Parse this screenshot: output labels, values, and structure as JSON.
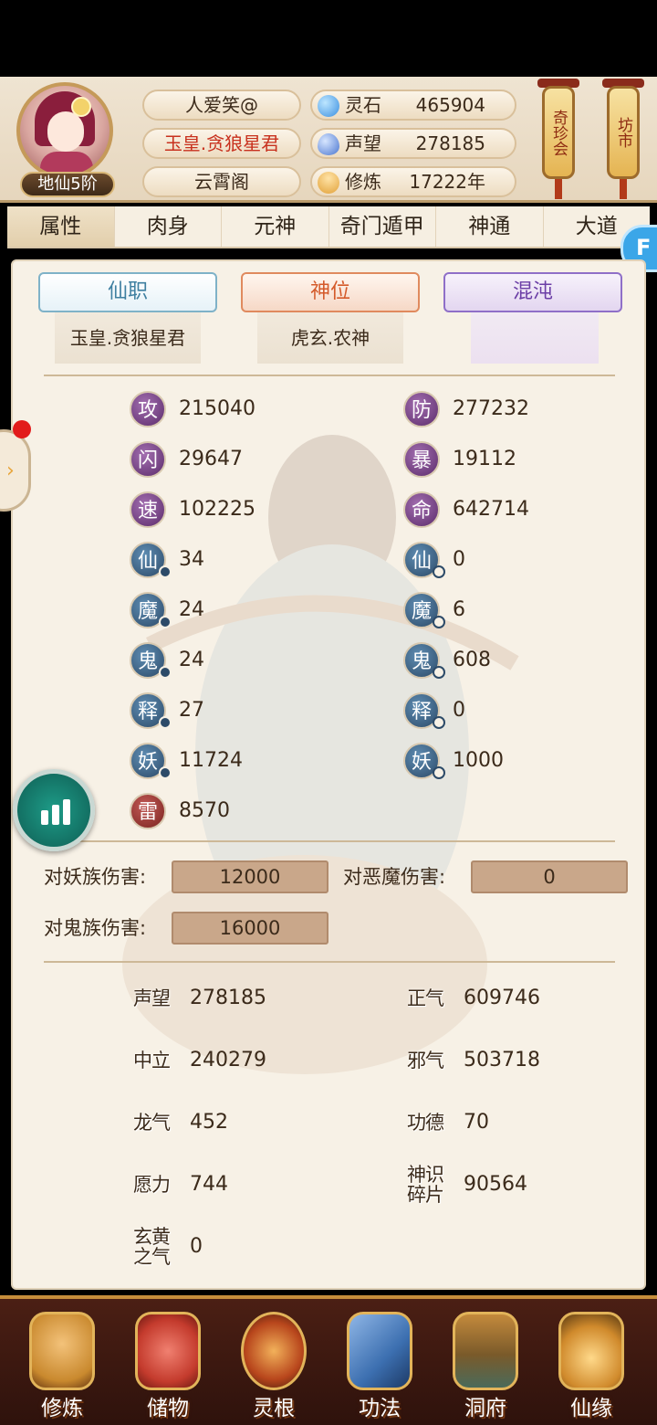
{
  "player": {
    "name": "人爱笑@",
    "title": "玉皇.贪狼星君",
    "sect": "云霄阁",
    "rank": "地仙5阶"
  },
  "resources": [
    {
      "label": "灵石",
      "value": "465904",
      "icon": "spirit-stone-icon",
      "color": "#3a8fe0"
    },
    {
      "label": "声望",
      "value": "278185",
      "icon": "reputation-icon",
      "color": "#4a76d0"
    },
    {
      "label": "修炼",
      "value": "17222年",
      "icon": "meditation-icon",
      "color": "#e2a23a"
    }
  ],
  "lanterns": [
    "奇珍会",
    "坊市"
  ],
  "tabs": [
    "属性",
    "肉身",
    "元神",
    "奇门遁甲",
    "神通",
    "大道"
  ],
  "float_chip": "F",
  "ranks": {
    "xian": {
      "head": "仙职",
      "value": "玉皇.贪狼星君"
    },
    "shen": {
      "head": "神位",
      "value": "虎玄.农神"
    },
    "hun": {
      "head": "混沌",
      "value": ""
    }
  },
  "stats_left": [
    {
      "char": "攻",
      "value": "215040"
    },
    {
      "char": "闪",
      "value": "29647"
    },
    {
      "char": "速",
      "value": "102225"
    },
    {
      "char": "仙",
      "value": "34"
    },
    {
      "char": "魔",
      "value": "24"
    },
    {
      "char": "鬼",
      "value": "24"
    },
    {
      "char": "释",
      "value": "27"
    },
    {
      "char": "妖",
      "value": "11724"
    },
    {
      "char": "雷",
      "value": "8570"
    }
  ],
  "stats_right": [
    {
      "char": "防",
      "value": "277232"
    },
    {
      "char": "暴",
      "value": "19112"
    },
    {
      "char": "命",
      "value": "642714"
    },
    {
      "char": "仙",
      "value": "0"
    },
    {
      "char": "魔",
      "value": "6"
    },
    {
      "char": "鬼",
      "value": "608"
    },
    {
      "char": "释",
      "value": "0"
    },
    {
      "char": "妖",
      "value": "1000"
    }
  ],
  "damage": {
    "vs_yao_label": "对妖族伤害:",
    "vs_yao_value": "12000",
    "vs_mo_label": "对恶魔伤害:",
    "vs_mo_value": "0",
    "vs_gui_label": "对鬼族伤害:",
    "vs_gui_value": "16000"
  },
  "resources2_left": [
    {
      "label": "声望",
      "value": "278185"
    },
    {
      "label": "中立",
      "value": "240279"
    },
    {
      "label": "龙气",
      "value": "452"
    },
    {
      "label": "愿力",
      "value": "744"
    },
    {
      "label": "玄黄之气",
      "value": "0"
    }
  ],
  "resources2_right": [
    {
      "label": "正气",
      "value": "609746"
    },
    {
      "label": "邪气",
      "value": "503718"
    },
    {
      "label": "功德",
      "value": "70"
    },
    {
      "label": "神识碎片",
      "value": "90564"
    }
  ],
  "nav": [
    {
      "label": "修炼",
      "icon": "cultivate-icon",
      "color": "#c9892e"
    },
    {
      "label": "储物",
      "icon": "storage-bag-icon",
      "color": "#c43b2d"
    },
    {
      "label": "灵根",
      "icon": "spirit-root-icon",
      "color": "#b8461c"
    },
    {
      "label": "功法",
      "icon": "skill-book-icon",
      "color": "#3c6fb0"
    },
    {
      "label": "洞府",
      "icon": "cave-house-icon",
      "color": "#7a5a2a"
    },
    {
      "label": "仙缘",
      "icon": "fate-gourd-icon",
      "color": "#d08a2c"
    }
  ]
}
